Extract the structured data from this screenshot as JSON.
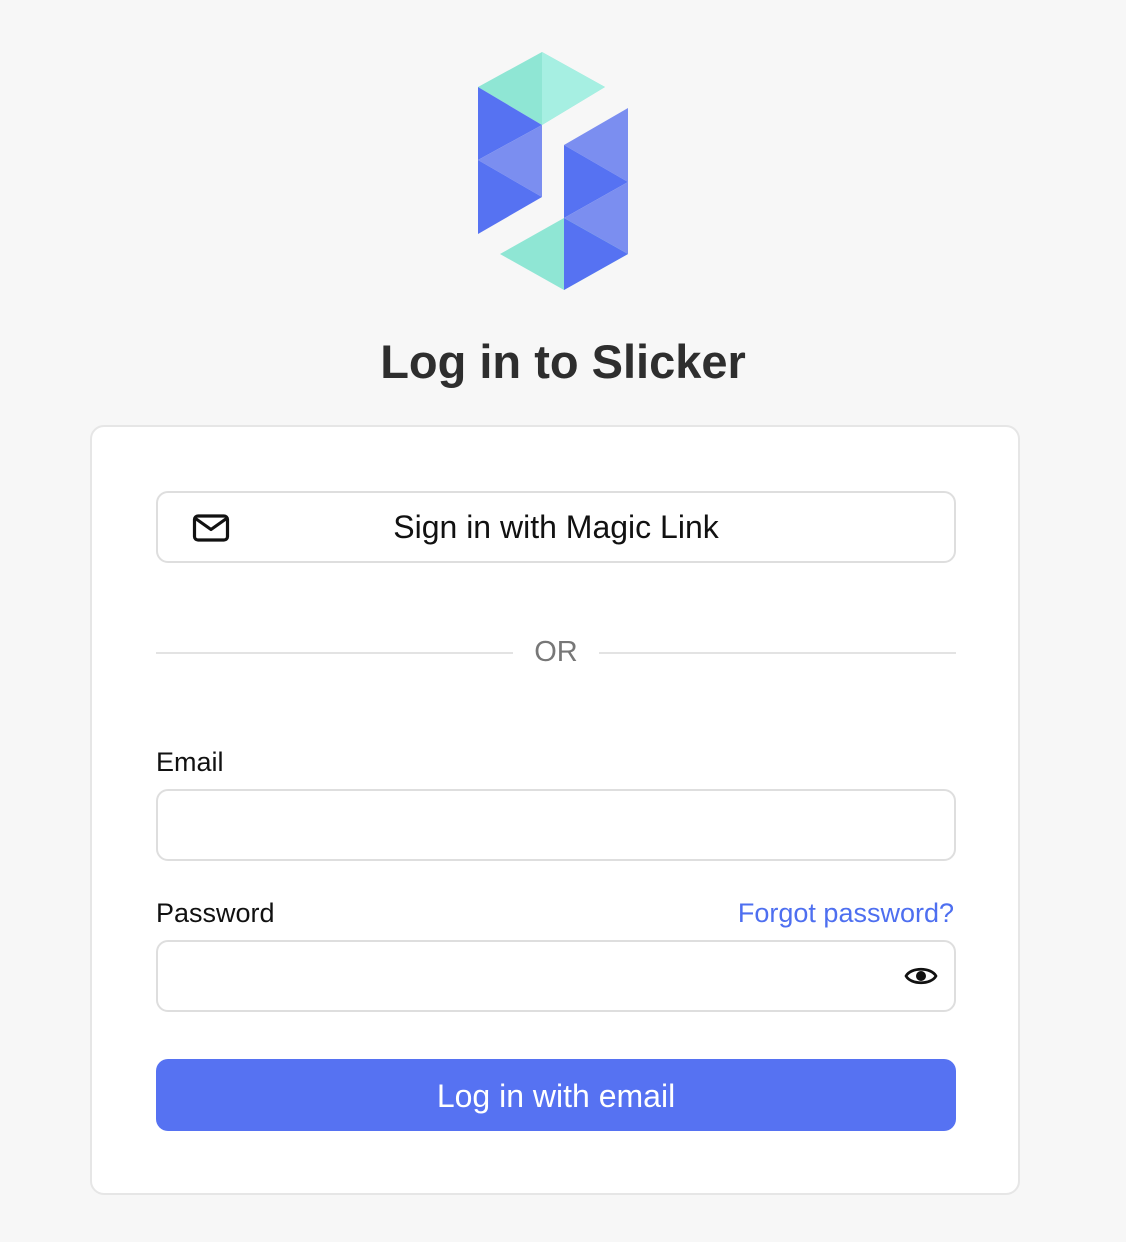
{
  "brand": {
    "logo_name": "slicker-logo",
    "colors": {
      "mint": "#8fe6d4",
      "mint_light": "#a6efe2",
      "blue": "#5672f2",
      "blue_light": "#7b8ef0"
    }
  },
  "header": {
    "title": "Log in to Slicker"
  },
  "magic_link": {
    "label": "Sign in with Magic Link",
    "icon": "mail-icon"
  },
  "divider": {
    "text": "OR"
  },
  "form": {
    "email_label": "Email",
    "email_value": "",
    "email_placeholder": "",
    "password_label": "Password",
    "password_value": "",
    "password_placeholder": "",
    "forgot_label": "Forgot password?",
    "toggle_icon": "eye-icon",
    "submit_label": "Log in with email"
  },
  "theme": {
    "accent": "#5672f2",
    "link": "#4e6ff0",
    "background": "#f7f7f7",
    "card": "#ffffff",
    "border": "#dedede"
  }
}
